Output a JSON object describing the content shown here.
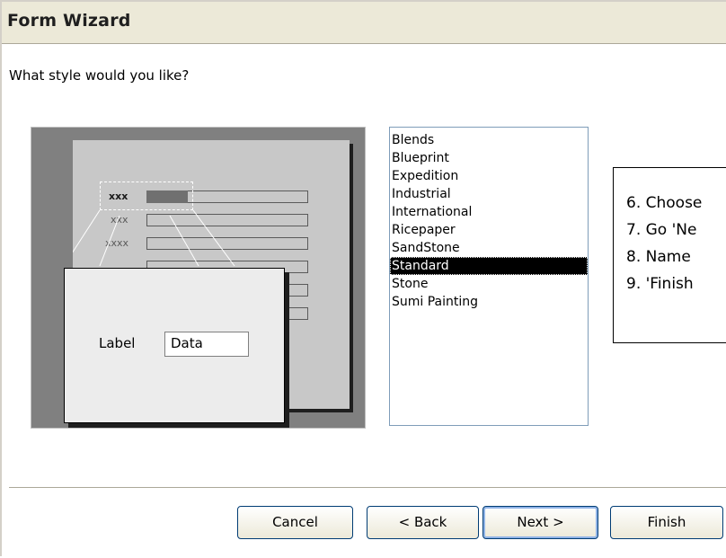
{
  "window": {
    "title": "Form Wizard"
  },
  "prompt": {
    "question": "What style would you like?"
  },
  "preview": {
    "placeholder_bold": "xxx",
    "placeholder_1": "xxx",
    "placeholder_2": "xxxx",
    "label": "Label",
    "data": "Data"
  },
  "style_list": {
    "items": [
      "Blends",
      "Blueprint",
      "Expedition",
      "Industrial",
      "International",
      "Ricepaper",
      "SandStone",
      "Standard",
      "Stone",
      "Sumi Painting"
    ],
    "selected": "Standard"
  },
  "note": {
    "lines": [
      "6. Choose",
      "7. Go 'Ne",
      "8. Name",
      "9. 'Finish"
    ]
  },
  "buttons": {
    "cancel": "Cancel",
    "back": "< Back",
    "next": "Next >",
    "finish": "Finish"
  }
}
